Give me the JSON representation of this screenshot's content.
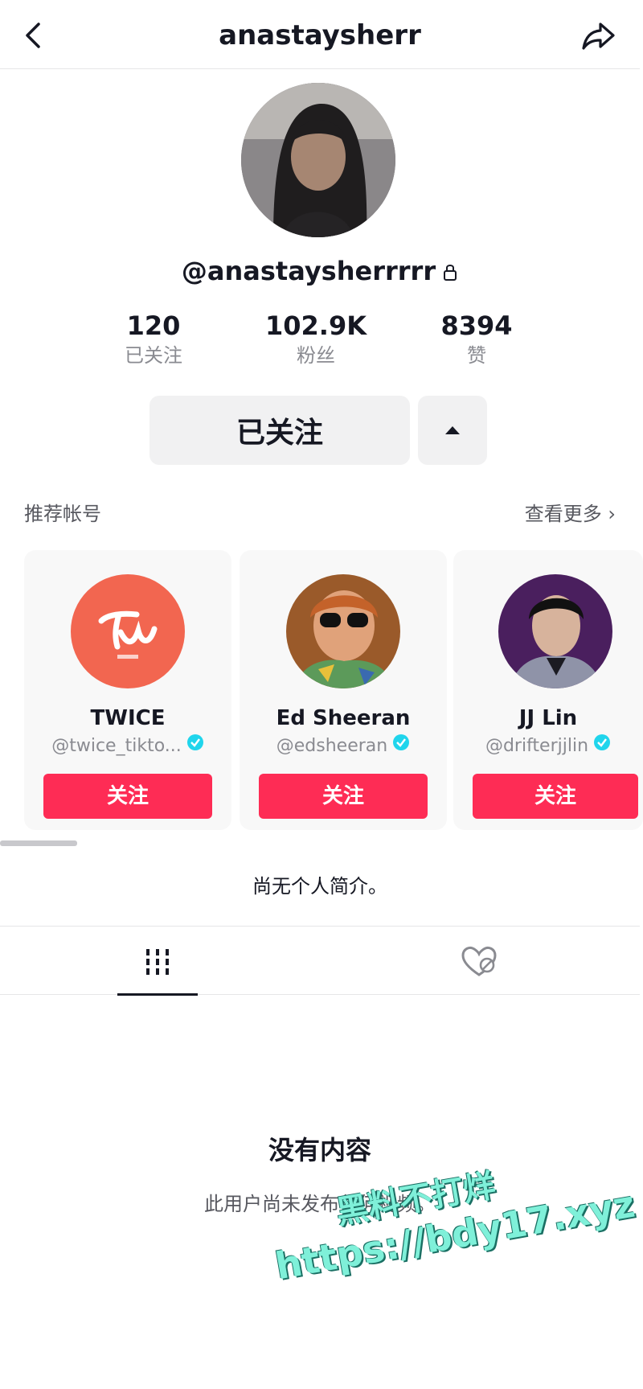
{
  "header": {
    "title": "anastaysherr"
  },
  "profile": {
    "handle": "@anastaysherrrrr",
    "stats": [
      {
        "value": "120",
        "label": "已关注"
      },
      {
        "value": "102.9K",
        "label": "粉丝"
      },
      {
        "value": "8394",
        "label": "赞"
      }
    ],
    "following_label": "已关注"
  },
  "suggested": {
    "title": "推荐帐号",
    "see_more": "查看更多",
    "accounts": [
      {
        "name": "TWICE",
        "id": "@twice_tikto...",
        "follow": "关注",
        "avatar_color": "#f26650"
      },
      {
        "name": "Ed Sheeran",
        "id": "@edsheeran",
        "follow": "关注",
        "avatar_color": "#9a5a2a"
      },
      {
        "name": "JJ Lin",
        "id": "@drifterjjlin",
        "follow": "关注",
        "avatar_color": "#4a1f5e"
      }
    ]
  },
  "bio": "尚无个人简介。",
  "empty": {
    "title": "没有内容",
    "description": "此用户尚未发布任何视频。"
  },
  "watermark": {
    "line1": "黑料不打烊",
    "line2": "https://bdy17.xyz"
  },
  "colors": {
    "accent": "#fe2c55",
    "verified": "#20d5ec"
  }
}
